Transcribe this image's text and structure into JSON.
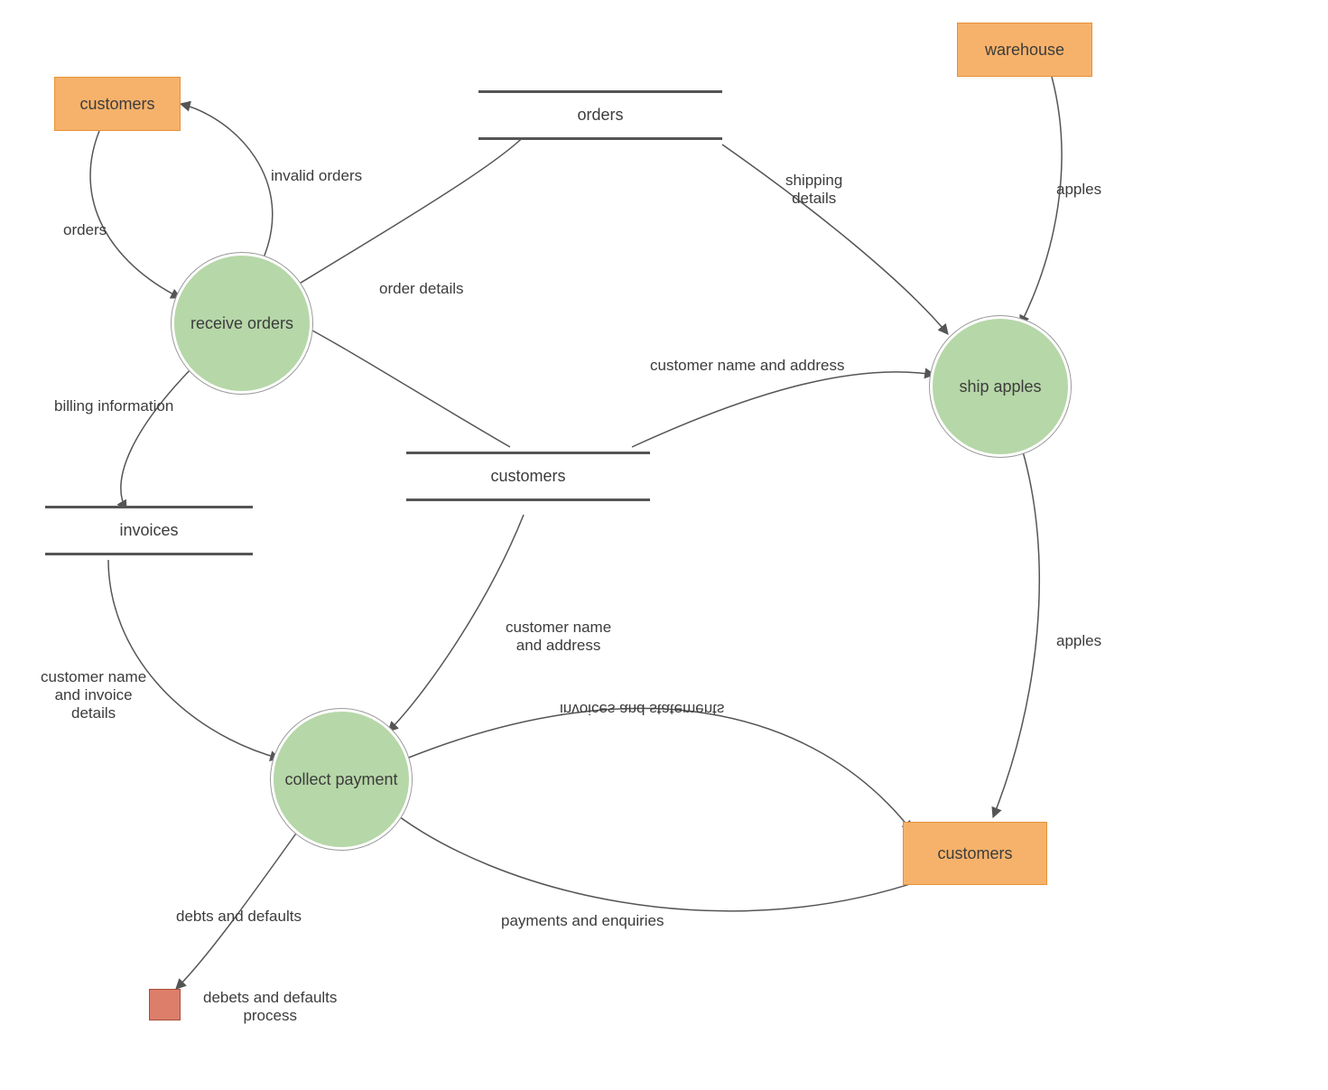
{
  "entities": {
    "customersTop": "customers",
    "warehouse": "warehouse",
    "customersBot": "customers"
  },
  "processes": {
    "receive": "receive orders",
    "ship": "ship apples",
    "collect": "collect\npayment"
  },
  "stores": {
    "orders": "orders",
    "invoices": "invoices",
    "customers": "customers"
  },
  "terminator": {
    "label": "debets and defaults\nprocess"
  },
  "flows": {
    "orders": "orders",
    "invalidOrders": "invalid orders",
    "orderDetails": "order details",
    "shippingDetails": "shipping\ndetails",
    "apples1": "apples",
    "billingInfo": "billing information",
    "custNameAddr1": "customer name and address",
    "custNameAddr2": "customer name\nand address",
    "custNameInv": "customer name\nand invoice\ndetails",
    "apples2": "apples",
    "invoicesStmt": "invoices and statements",
    "paymentsEnq": "payments and enquiries",
    "debtsDefaults": "debts and defaults"
  }
}
